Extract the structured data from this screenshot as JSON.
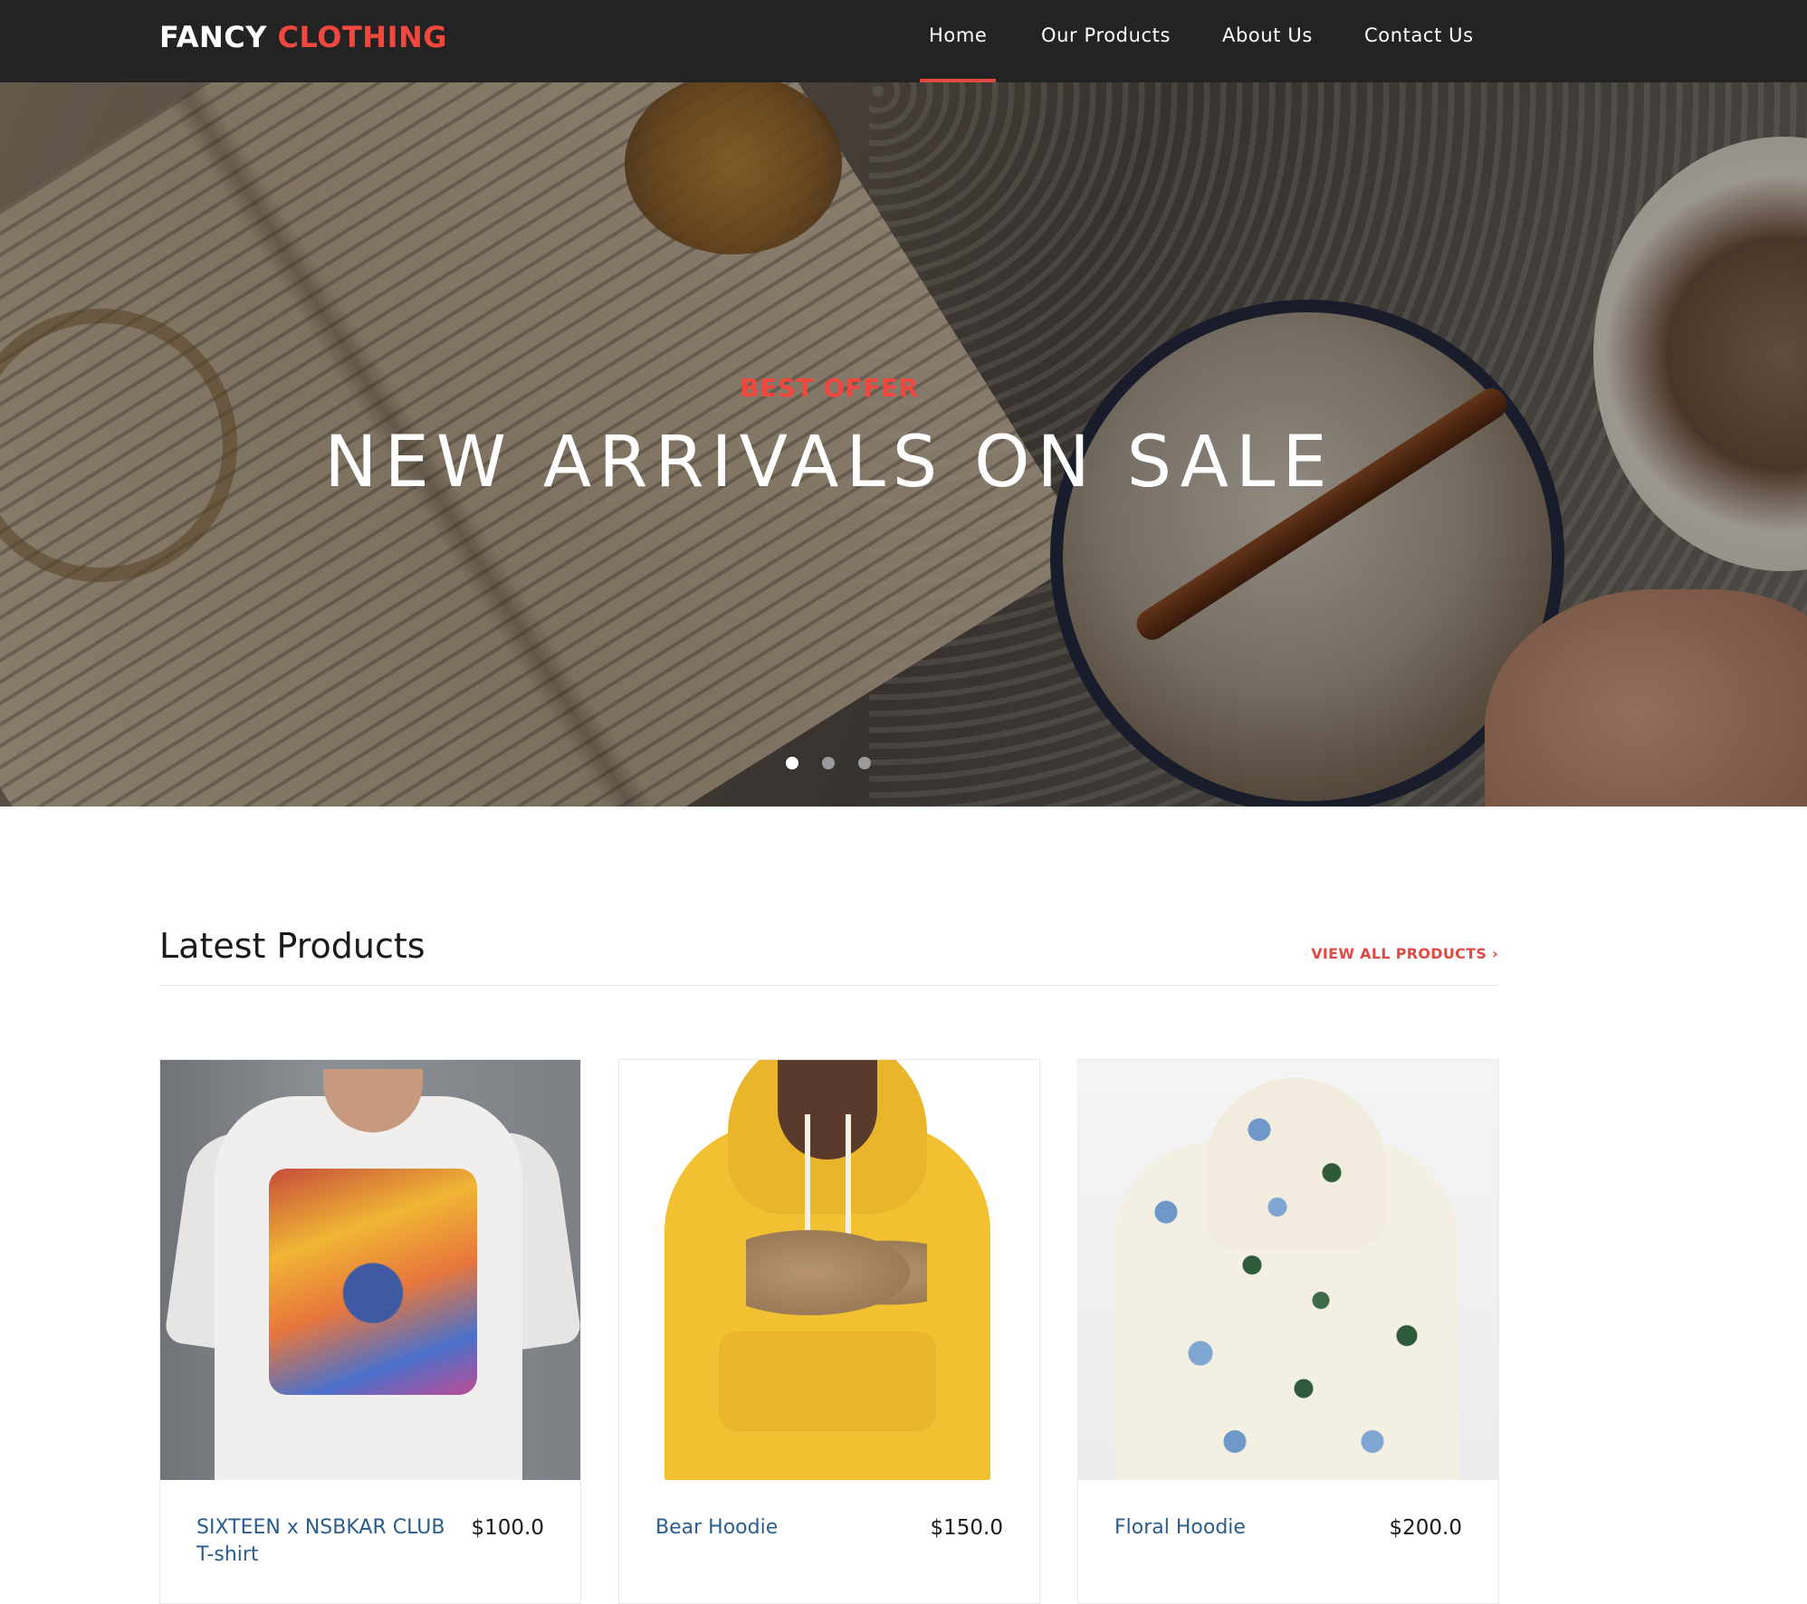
{
  "brand": {
    "first": "FANCY",
    "second": "CLOTHING"
  },
  "nav": {
    "items": [
      {
        "label": "Home",
        "active": true
      },
      {
        "label": "Our Products",
        "active": false
      },
      {
        "label": "About Us",
        "active": false
      },
      {
        "label": "Contact Us",
        "active": false
      }
    ]
  },
  "hero": {
    "kicker": "BEST OFFER",
    "heading": "NEW ARRIVALS ON SALE",
    "slides": 3,
    "active_slide": 1
  },
  "latest": {
    "title": "Latest Products",
    "view_all": "VIEW ALL PRODUCTS",
    "chevron": "›"
  },
  "products": [
    {
      "name": "SIXTEEN x NSBKAR CLUB T-shirt",
      "price": "$100.0",
      "image": "graphic-tshirt"
    },
    {
      "name": "Bear Hoodie",
      "price": "$150.0",
      "image": "yellow-bear-hoodie"
    },
    {
      "name": "Floral Hoodie",
      "price": "$200.0",
      "image": "floral-hoodie"
    }
  ],
  "colors": {
    "accent": "#e14a43",
    "navbar": "#232323",
    "link": "#2a5d8c"
  }
}
